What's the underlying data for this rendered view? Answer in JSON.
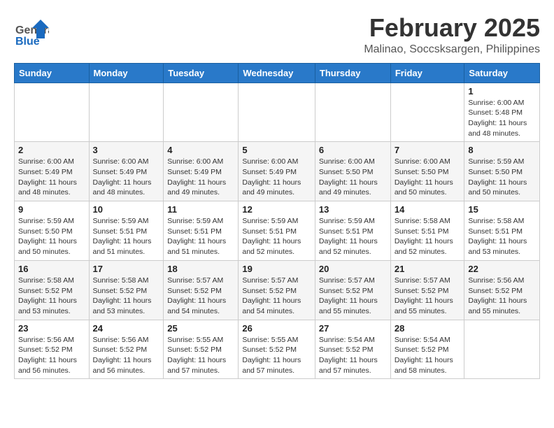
{
  "header": {
    "logo_general": "General",
    "logo_blue": "Blue",
    "month_year": "February 2025",
    "location": "Malinao, Soccsksargen, Philippines"
  },
  "days_of_week": [
    "Sunday",
    "Monday",
    "Tuesday",
    "Wednesday",
    "Thursday",
    "Friday",
    "Saturday"
  ],
  "weeks": [
    [
      {
        "day": "",
        "info": ""
      },
      {
        "day": "",
        "info": ""
      },
      {
        "day": "",
        "info": ""
      },
      {
        "day": "",
        "info": ""
      },
      {
        "day": "",
        "info": ""
      },
      {
        "day": "",
        "info": ""
      },
      {
        "day": "1",
        "info": "Sunrise: 6:00 AM\nSunset: 5:48 PM\nDaylight: 11 hours and 48 minutes."
      }
    ],
    [
      {
        "day": "2",
        "info": "Sunrise: 6:00 AM\nSunset: 5:49 PM\nDaylight: 11 hours and 48 minutes."
      },
      {
        "day": "3",
        "info": "Sunrise: 6:00 AM\nSunset: 5:49 PM\nDaylight: 11 hours and 48 minutes."
      },
      {
        "day": "4",
        "info": "Sunrise: 6:00 AM\nSunset: 5:49 PM\nDaylight: 11 hours and 49 minutes."
      },
      {
        "day": "5",
        "info": "Sunrise: 6:00 AM\nSunset: 5:49 PM\nDaylight: 11 hours and 49 minutes."
      },
      {
        "day": "6",
        "info": "Sunrise: 6:00 AM\nSunset: 5:50 PM\nDaylight: 11 hours and 49 minutes."
      },
      {
        "day": "7",
        "info": "Sunrise: 6:00 AM\nSunset: 5:50 PM\nDaylight: 11 hours and 50 minutes."
      },
      {
        "day": "8",
        "info": "Sunrise: 5:59 AM\nSunset: 5:50 PM\nDaylight: 11 hours and 50 minutes."
      }
    ],
    [
      {
        "day": "9",
        "info": "Sunrise: 5:59 AM\nSunset: 5:50 PM\nDaylight: 11 hours and 50 minutes."
      },
      {
        "day": "10",
        "info": "Sunrise: 5:59 AM\nSunset: 5:51 PM\nDaylight: 11 hours and 51 minutes."
      },
      {
        "day": "11",
        "info": "Sunrise: 5:59 AM\nSunset: 5:51 PM\nDaylight: 11 hours and 51 minutes."
      },
      {
        "day": "12",
        "info": "Sunrise: 5:59 AM\nSunset: 5:51 PM\nDaylight: 11 hours and 52 minutes."
      },
      {
        "day": "13",
        "info": "Sunrise: 5:59 AM\nSunset: 5:51 PM\nDaylight: 11 hours and 52 minutes."
      },
      {
        "day": "14",
        "info": "Sunrise: 5:58 AM\nSunset: 5:51 PM\nDaylight: 11 hours and 52 minutes."
      },
      {
        "day": "15",
        "info": "Sunrise: 5:58 AM\nSunset: 5:51 PM\nDaylight: 11 hours and 53 minutes."
      }
    ],
    [
      {
        "day": "16",
        "info": "Sunrise: 5:58 AM\nSunset: 5:52 PM\nDaylight: 11 hours and 53 minutes."
      },
      {
        "day": "17",
        "info": "Sunrise: 5:58 AM\nSunset: 5:52 PM\nDaylight: 11 hours and 53 minutes."
      },
      {
        "day": "18",
        "info": "Sunrise: 5:57 AM\nSunset: 5:52 PM\nDaylight: 11 hours and 54 minutes."
      },
      {
        "day": "19",
        "info": "Sunrise: 5:57 AM\nSunset: 5:52 PM\nDaylight: 11 hours and 54 minutes."
      },
      {
        "day": "20",
        "info": "Sunrise: 5:57 AM\nSunset: 5:52 PM\nDaylight: 11 hours and 55 minutes."
      },
      {
        "day": "21",
        "info": "Sunrise: 5:57 AM\nSunset: 5:52 PM\nDaylight: 11 hours and 55 minutes."
      },
      {
        "day": "22",
        "info": "Sunrise: 5:56 AM\nSunset: 5:52 PM\nDaylight: 11 hours and 55 minutes."
      }
    ],
    [
      {
        "day": "23",
        "info": "Sunrise: 5:56 AM\nSunset: 5:52 PM\nDaylight: 11 hours and 56 minutes."
      },
      {
        "day": "24",
        "info": "Sunrise: 5:56 AM\nSunset: 5:52 PM\nDaylight: 11 hours and 56 minutes."
      },
      {
        "day": "25",
        "info": "Sunrise: 5:55 AM\nSunset: 5:52 PM\nDaylight: 11 hours and 57 minutes."
      },
      {
        "day": "26",
        "info": "Sunrise: 5:55 AM\nSunset: 5:52 PM\nDaylight: 11 hours and 57 minutes."
      },
      {
        "day": "27",
        "info": "Sunrise: 5:54 AM\nSunset: 5:52 PM\nDaylight: 11 hours and 57 minutes."
      },
      {
        "day": "28",
        "info": "Sunrise: 5:54 AM\nSunset: 5:52 PM\nDaylight: 11 hours and 58 minutes."
      },
      {
        "day": "",
        "info": ""
      }
    ]
  ]
}
